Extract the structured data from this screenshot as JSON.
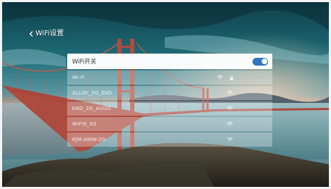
{
  "header": {
    "back_label": "WiFi设置"
  },
  "wifi_toggle": {
    "label": "WiFi开关",
    "enabled": true,
    "accent": "#2f74c0"
  },
  "networks": [
    {
      "ssid": "Wi-Fi",
      "status": "",
      "locked": true
    },
    {
      "ssid": "ALLOK_5G_END",
      "status": "",
      "locked": true
    },
    {
      "ssid": "END_2G_AUGO",
      "status": "",
      "locked": true
    },
    {
      "ssid": "WIFI6_5G",
      "status": "",
      "locked": true
    },
    {
      "ssid": "KJM-AWW-2G",
      "status": "",
      "locked": true
    }
  ]
}
